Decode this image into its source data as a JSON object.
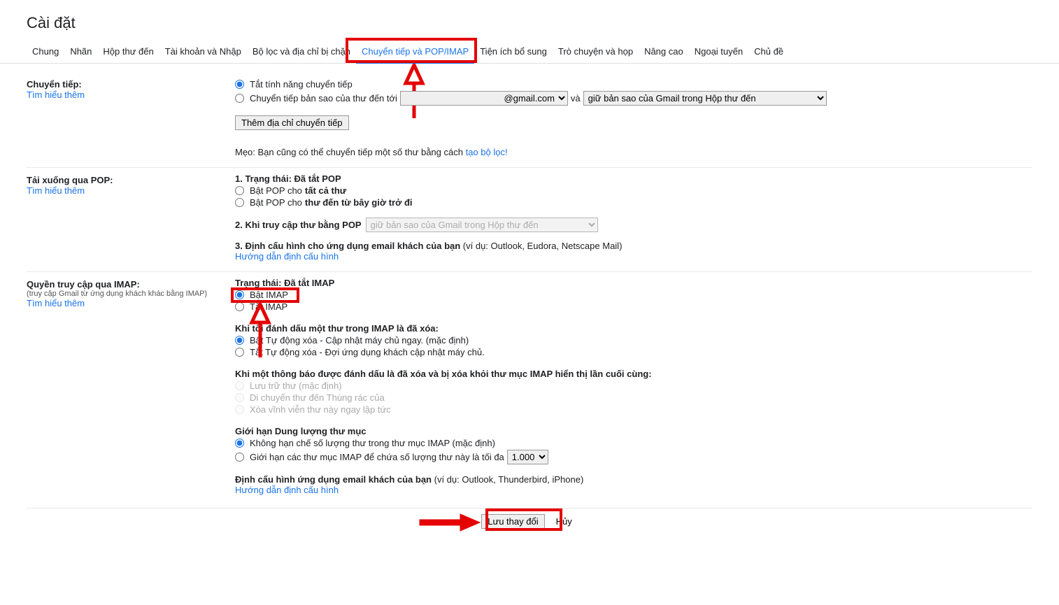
{
  "title": "Cài đặt",
  "tabs": [
    "Chung",
    "Nhãn",
    "Hộp thư đến",
    "Tài khoản và Nhập",
    "Bộ lọc và địa chỉ bị chặn",
    "Chuyển tiếp và POP/IMAP",
    "Tiện ích bổ sung",
    "Trò chuyện và họp",
    "Nâng cao",
    "Ngoại tuyến",
    "Chủ đề"
  ],
  "activeTab": "Chuyển tiếp và POP/IMAP",
  "forward": {
    "label": "Chuyển tiếp:",
    "learn": "Tìm hiểu thêm",
    "off": "Tắt tính năng chuyển tiếp",
    "copy_prefix": "Chuyển tiếp bản sao của thư đến tới",
    "email_select": "@gmail.com",
    "and": "và",
    "keep_select": "giữ bản sao của Gmail trong Hộp thư đến",
    "add_btn": "Thêm địa chỉ chuyển tiếp",
    "tip_prefix": "Mẹo: Bạn cũng có thể chuyển tiếp một số thư bằng cách ",
    "tip_link": "tạo bộ lọc!"
  },
  "pop": {
    "label": "Tải xuống qua POP:",
    "learn": "Tìm hiểu thêm",
    "status_label": "1. Trạng thái: ",
    "status_value": "Đã tắt POP",
    "all_prefix": "Bật POP cho ",
    "all_bold": "tất cả thư",
    "now_prefix": "Bật POP cho ",
    "now_bold": "thư đến từ bây giờ trở đi",
    "access_label": "2. Khi truy cập thư bằng POP",
    "access_select": "giữ bản sao của Gmail trong Hộp thư đến",
    "config_label": "3. Định cấu hình cho ứng dụng email khách của bạn ",
    "config_eg": "(ví dụ: Outlook, Eudora, Netscape Mail)",
    "config_link": "Hướng dẫn định cấu hình"
  },
  "imap": {
    "label": "Quyền truy cập qua IMAP:",
    "sub": "(truy cập Gmail từ ứng dụng khách khác bằng IMAP)",
    "learn": "Tìm hiểu thêm",
    "status_label": "Trạng thái: ",
    "status_value": "Đã tắt IMAP",
    "on": "Bật IMAP",
    "off": "Tắt IMAP",
    "auto_head": "Khi tôi đánh dấu một thư trong IMAP là đã xóa:",
    "auto_on": "Bật Tự động xóa - Cập nhật máy chủ ngay. (mặc định)",
    "auto_off": "Tắt Tự động xóa - Đợi ứng dụng khách cập nhật máy chủ.",
    "removed_head": "Khi một thông báo được đánh dấu là đã xóa và bị xóa khỏi thư mục IMAP hiển thị lần cuối cùng:",
    "removed_1": "Lưu trữ thư (mặc định)",
    "removed_2": "Di chuyển thư đến Thùng rác của",
    "removed_3": "Xóa vĩnh viễn thư này ngay lập tức",
    "limit_head": "Giới hạn Dung lượng thư mục",
    "limit_off": "Không hạn chế số lượng thư trong thư mục IMAP (mặc định)",
    "limit_on": "Giới hạn các thư mục IMAP để chứa số lượng thư này là tối đa",
    "limit_select": "1.000",
    "config_label": "Định cấu hình ứng dụng email khách của bạn ",
    "config_eg": "(ví dụ: Outlook, Thunderbird, iPhone)",
    "config_link": "Hướng dẫn định cấu hình"
  },
  "save": {
    "save_btn": "Lưu thay đổi",
    "cancel_btn": "Hủy"
  }
}
